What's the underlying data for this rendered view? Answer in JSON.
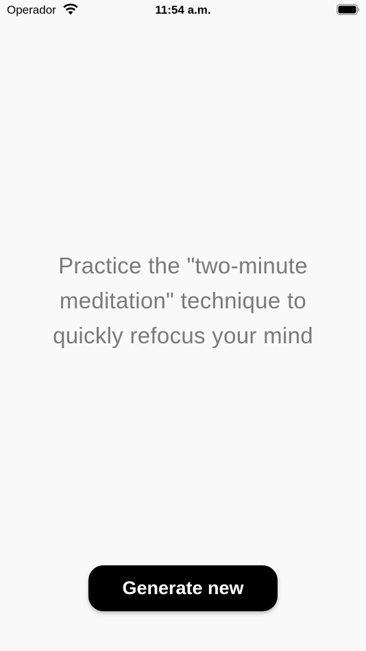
{
  "status_bar": {
    "carrier": "Operador",
    "time": "11:54 a.m.",
    "wifi_icon": "wifi-icon",
    "battery_icon": "battery-full-icon"
  },
  "main": {
    "message": "Practice the \"two-minute meditation\" technique to quickly refocus your mind"
  },
  "actions": {
    "generate_label": "Generate new"
  },
  "colors": {
    "background": "#f9f9f9",
    "message_text": "#7a7a7a",
    "button_background": "#000000",
    "button_text": "#ffffff"
  }
}
